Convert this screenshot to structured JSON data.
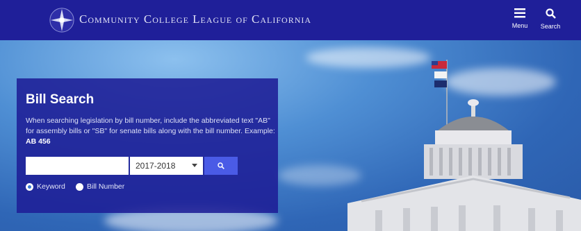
{
  "header": {
    "title": "Community College League of California",
    "menu_label": "Menu",
    "search_label": "Search"
  },
  "bill_search": {
    "title": "Bill Search",
    "description": "When searching legislation by bill number, include the abbreviated text \"AB\" for assembly bills or \"SB\" for senate bills along with the bill number. Example: ",
    "example": "AB 456",
    "search_value": "",
    "session_selected": "2017-2018",
    "radio_keyword_label": "Keyword",
    "radio_bill_label": "Bill Number",
    "selected_mode": "Keyword"
  },
  "colors": {
    "header_bg": "#1f1f99",
    "panel_bg": "#1e1e96",
    "button_bg": "#4a5be6"
  }
}
